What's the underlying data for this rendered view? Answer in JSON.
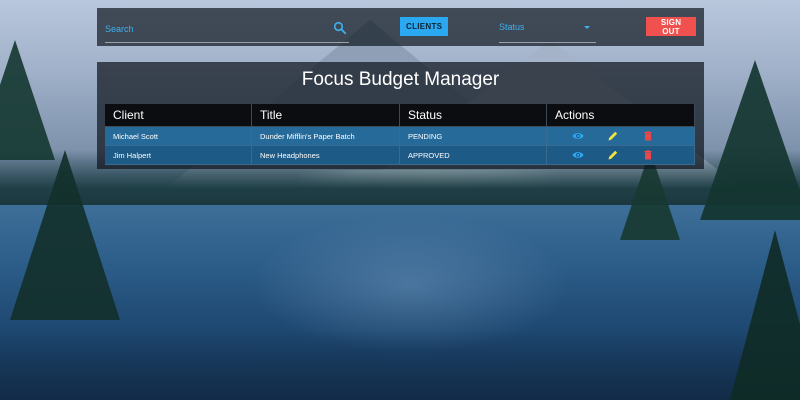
{
  "header": {
    "search_placeholder": "Search",
    "clients_label": "CLIENTS",
    "status_label": "Status",
    "signout_label": "SIGN OUT"
  },
  "page": {
    "title": "Focus Budget Manager"
  },
  "table": {
    "columns": [
      "Client",
      "Title",
      "Status",
      "Actions"
    ],
    "rows": [
      {
        "client": "Michael Scott",
        "title": "Dunder Mifflin's Paper Batch",
        "status": "PENDING"
      },
      {
        "client": "Jim Halpert",
        "title": "New Headphones",
        "status": "APPROVED"
      }
    ]
  },
  "icons": {
    "search": "search-icon",
    "status_dropdown": "chevron-down-icon",
    "view": "eye-icon",
    "edit": "pencil-icon",
    "delete": "trash-icon"
  },
  "colors": {
    "accent_blue": "#2aa8f2",
    "danger_red": "#f0504e",
    "edit_yellow": "#f2e33d",
    "delete_red": "#e8474b"
  }
}
